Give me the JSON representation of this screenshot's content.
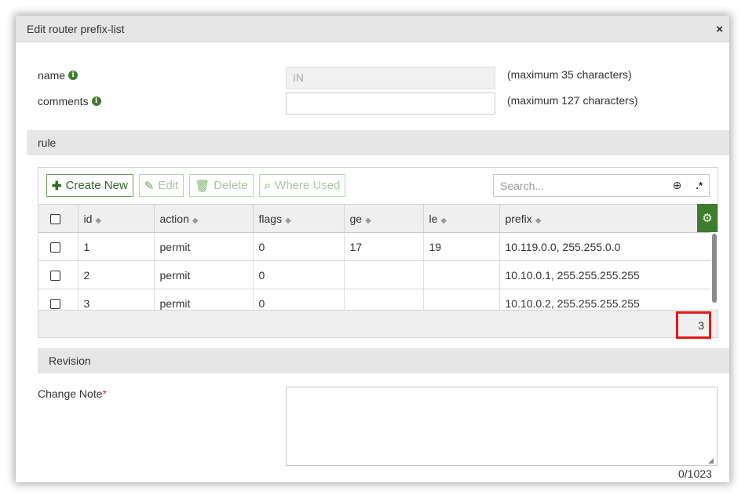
{
  "dialog": {
    "title": "Edit router prefix-list",
    "close_icon": "×"
  },
  "form": {
    "name_label": "name",
    "name_value": "IN",
    "name_hint": "(maximum 35 characters)",
    "comments_label": "comments",
    "comments_value": "",
    "comments_hint": "(maximum 127 characters)"
  },
  "rule_section": {
    "title": "rule",
    "toolbar": {
      "create_new": "Create New",
      "edit": "Edit",
      "delete": "Delete",
      "where_used": "Where Used"
    },
    "search_placeholder": "Search...",
    "columns": [
      "id",
      "action",
      "flags",
      "ge",
      "le",
      "prefix"
    ],
    "rows": [
      {
        "id": "1",
        "action": "permit",
        "flags": "0",
        "ge": "17",
        "le": "19",
        "prefix": "10.119.0.0, 255.255.0.0"
      },
      {
        "id": "2",
        "action": "permit",
        "flags": "0",
        "ge": "",
        "le": "",
        "prefix": "10.10.0.1, 255.255.255.255"
      },
      {
        "id": "3",
        "action": "permit",
        "flags": "0",
        "ge": "",
        "le": "",
        "prefix": "10.10.0.2, 255.255.255.255"
      }
    ],
    "row_count": "3"
  },
  "revision_section": {
    "title": "Revision",
    "change_note_label": "Change Note",
    "required_marker": "*",
    "char_count": "0/1023"
  },
  "colors": {
    "accent_green": "#3f7d2e",
    "highlight_red": "#e01b1b",
    "header_gray": "#e6e6e6"
  },
  "icons": {
    "info": "info-icon",
    "plus": "plus-icon",
    "edit": "edit-icon",
    "trash": "trash-icon",
    "search": "search-icon",
    "regex": "regex-icon",
    "gear": "gear-icon",
    "sort": "sort-icon"
  }
}
